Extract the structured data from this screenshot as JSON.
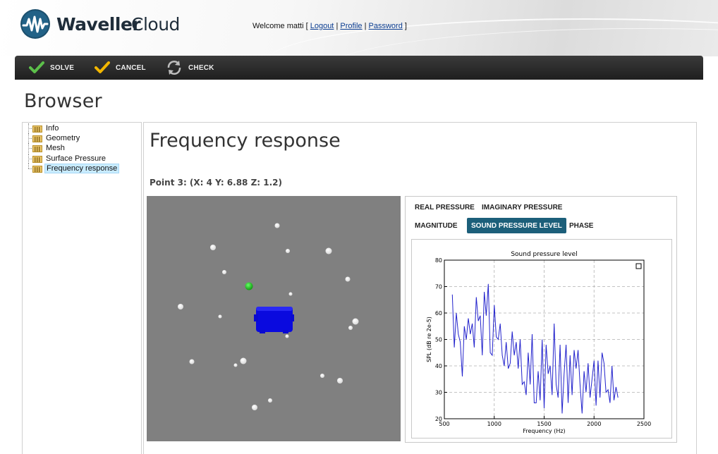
{
  "header": {
    "logo_brand": "Waveller",
    "logo_product": "Cloud",
    "welcome_prefix": "Welcome matti [",
    "links": [
      {
        "label": "Logout"
      },
      {
        "label": "Profile"
      },
      {
        "label": "Password"
      }
    ],
    "separator": "|",
    "welcome_suffix": "]"
  },
  "toolbar": {
    "solve_label": "SOLVE",
    "cancel_label": "CANCEL",
    "check_label": "CHECK"
  },
  "page": {
    "title": "Browser"
  },
  "tree": {
    "items": [
      {
        "label": "Info",
        "selected": false
      },
      {
        "label": "Geometry",
        "selected": false
      },
      {
        "label": "Mesh",
        "selected": false
      },
      {
        "label": "Surface Pressure",
        "selected": false
      },
      {
        "label": "Frequency response",
        "selected": true
      }
    ]
  },
  "main": {
    "title": "Frequency response",
    "point_label": "Point 3: (X: 4 Y: 6.88 Z: 1.2)",
    "tabs": [
      {
        "label": "REAL PRESSURE",
        "active": false
      },
      {
        "label": "IMAGINARY PRESSURE",
        "active": false
      },
      {
        "label": "MAGNITUDE",
        "active": false
      },
      {
        "label": "SOUND PRESSURE LEVEL",
        "active": true
      },
      {
        "label": "PHASE",
        "active": false
      }
    ]
  },
  "colors": {
    "toolbar_bg": "#262626",
    "active_tab": "#1c5f7a",
    "viewport_bg": "#808080",
    "source_box": "#0a0adf",
    "selected_point": "#22cc22",
    "series_line": "#2222cc",
    "check_icon_green": "#4caf50",
    "check_icon_yellow": "#f0b400"
  },
  "chart_data": {
    "type": "line",
    "title": "Sound pressure level",
    "xlabel": "Frequency (Hz)",
    "ylabel": "SPL (dB re 2e-5)",
    "xlim": [
      500,
      2500
    ],
    "ylim": [
      20,
      80
    ],
    "xticks": [
      500,
      1000,
      1500,
      2000,
      2500
    ],
    "yticks": [
      20,
      30,
      40,
      50,
      60,
      70,
      80
    ],
    "grid": true,
    "legend": "top-right",
    "series": [
      {
        "x": [
          580,
          600,
          620,
          640,
          660,
          680,
          700,
          720,
          740,
          760,
          780,
          800,
          820,
          840,
          860,
          880,
          900,
          920,
          940,
          960,
          980,
          1000,
          1020,
          1040,
          1060,
          1080,
          1100,
          1120,
          1140,
          1160,
          1180,
          1200,
          1220,
          1240,
          1260,
          1280,
          1300,
          1320,
          1340,
          1360,
          1380,
          1400,
          1420,
          1440,
          1460,
          1480,
          1500,
          1520,
          1540,
          1560,
          1580,
          1600,
          1620,
          1640,
          1660,
          1680,
          1700,
          1720,
          1740,
          1760,
          1780,
          1800,
          1820,
          1840,
          1860,
          1880,
          1900,
          1920,
          1940,
          1960,
          1980,
          2000,
          2020,
          2040,
          2060,
          2080,
          2100,
          2120,
          2140,
          2160,
          2180,
          2200,
          2220,
          2240
        ],
        "y": [
          67,
          47,
          60,
          52,
          49,
          36,
          55,
          50,
          58,
          52,
          56,
          47,
          66,
          57,
          59,
          44,
          68,
          59,
          71,
          45,
          44,
          63,
          51,
          50,
          56,
          44,
          40,
          49,
          39,
          41,
          53,
          44,
          49,
          39,
          50,
          33,
          34,
          29,
          45,
          33,
          52,
          26,
          26,
          38,
          27,
          50,
          24,
          48,
          37,
          40,
          29,
          56,
          33,
          28,
          48,
          22,
          37,
          48,
          26,
          44,
          29,
          46,
          39,
          46,
          33,
          22,
          38,
          30,
          41,
          28,
          35,
          42,
          25,
          42,
          28,
          45,
          41,
          30,
          31,
          26,
          40,
          27,
          32,
          28
        ]
      }
    ]
  }
}
